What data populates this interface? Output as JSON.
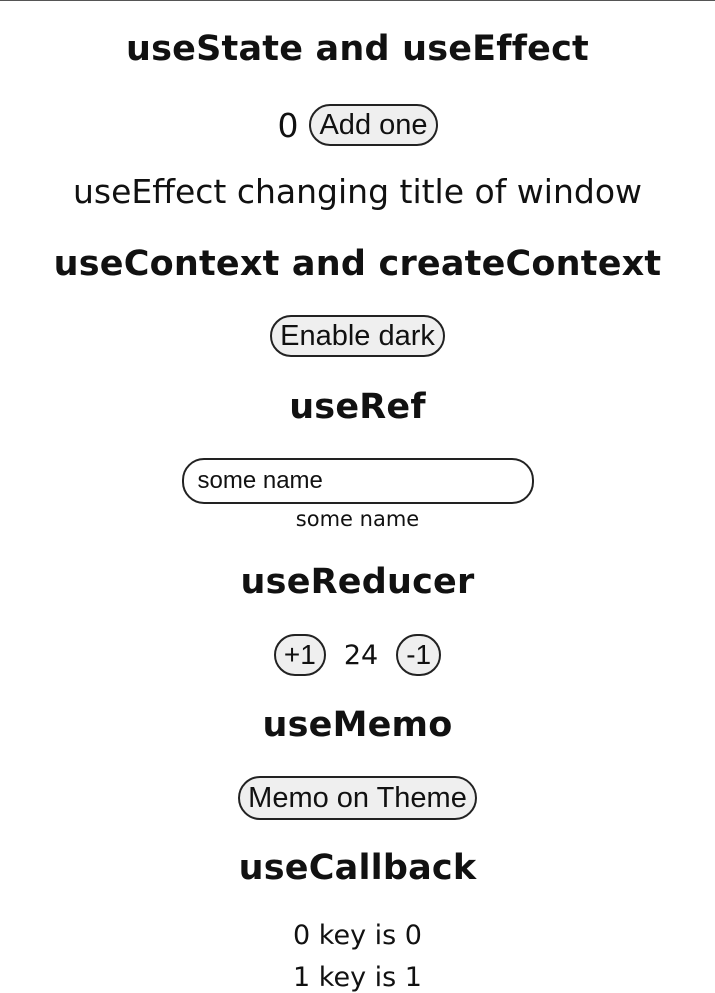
{
  "sections": {
    "state_effect": {
      "heading": "useState and useEffect",
      "count": "0",
      "add_button_label": "Add one",
      "effect_text": "useEffect changing title of window"
    },
    "context": {
      "heading": "useContext and createContext",
      "dark_button_label": "Enable dark"
    },
    "ref": {
      "heading": "useRef",
      "input_value": "some name",
      "output_text": "some name"
    },
    "reducer": {
      "heading": "useReducer",
      "increment_label": "+1",
      "value": "24",
      "decrement_label": "-1"
    },
    "memo": {
      "heading": "useMemo",
      "memo_button_label": "Memo on Theme"
    },
    "callback": {
      "heading": "useCallback",
      "lines": [
        "0 key is 0",
        "1 key is 1"
      ]
    }
  }
}
